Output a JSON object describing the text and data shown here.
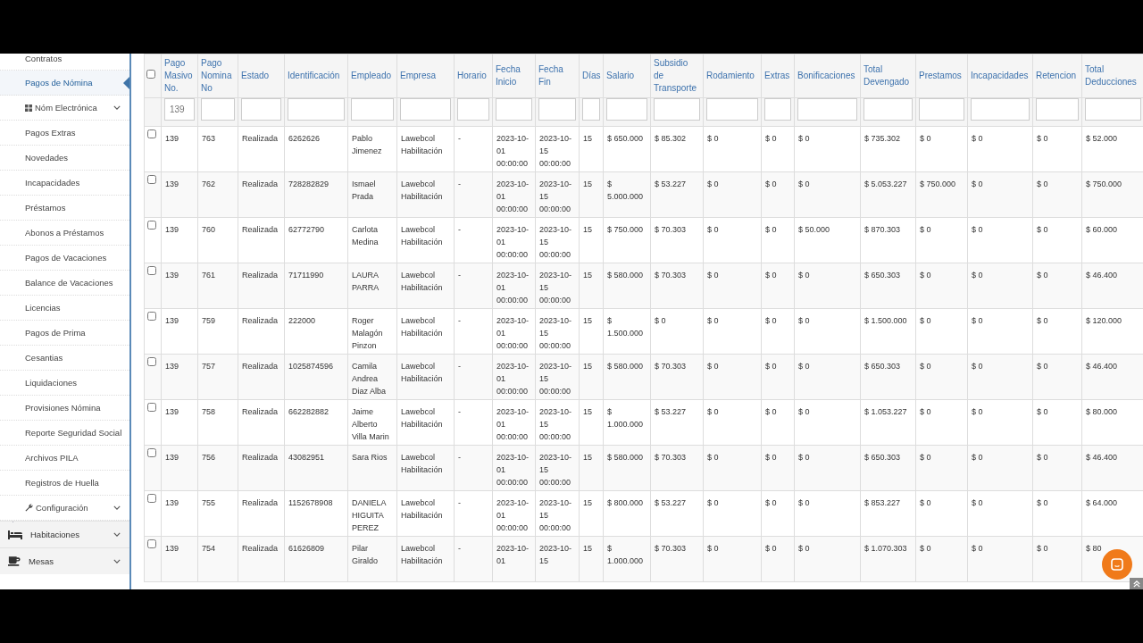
{
  "sidebar": {
    "items": [
      {
        "kind": "link",
        "label": "Contratos",
        "selected": false
      },
      {
        "kind": "link",
        "label": "Pagos de Nómina",
        "selected": true
      },
      {
        "kind": "submenu",
        "label": "Nóm Electrónica",
        "selected": false
      },
      {
        "kind": "link",
        "label": "Pagos Extras",
        "selected": false
      },
      {
        "kind": "link",
        "label": "Novedades",
        "selected": false
      },
      {
        "kind": "link",
        "label": "Incapacidades",
        "selected": false
      },
      {
        "kind": "link",
        "label": "Préstamos",
        "selected": false
      },
      {
        "kind": "link",
        "label": "Abonos a Préstamos",
        "selected": false
      },
      {
        "kind": "link",
        "label": "Pagos de Vacaciones",
        "selected": false
      },
      {
        "kind": "link",
        "label": "Balance de Vacaciones",
        "selected": false
      },
      {
        "kind": "link",
        "label": "Licencias",
        "selected": false
      },
      {
        "kind": "link",
        "label": "Pagos de Prima",
        "selected": false
      },
      {
        "kind": "link",
        "label": "Cesantias",
        "selected": false
      },
      {
        "kind": "link",
        "label": "Liquidaciones",
        "selected": false
      },
      {
        "kind": "link",
        "label": "Provisiones Nómina",
        "selected": false
      },
      {
        "kind": "link",
        "label": "Reporte Seguridad Social",
        "selected": false
      },
      {
        "kind": "link",
        "label": "Archivos PILA",
        "selected": false
      },
      {
        "kind": "link",
        "label": "Registros de Huella",
        "selected": false
      },
      {
        "kind": "submenu",
        "label": "Configuración",
        "selected": false
      },
      {
        "kind": "module",
        "label": "Habitaciones",
        "selected": false
      },
      {
        "kind": "module",
        "label": "Mesas",
        "selected": false
      }
    ]
  },
  "table": {
    "header_checkbox": {
      "checked": false
    },
    "columns": [
      {
        "label": "Pago Masivo No.",
        "filter": "139"
      },
      {
        "label": "Pago Nomina No"
      },
      {
        "label": "Estado"
      },
      {
        "label": "Identificación"
      },
      {
        "label": "Empleado"
      },
      {
        "label": "Empresa"
      },
      {
        "label": "Horario"
      },
      {
        "label": "Fecha Inicio"
      },
      {
        "label": "Fecha Fin"
      },
      {
        "label": "Días"
      },
      {
        "label": "Salario"
      },
      {
        "label": "Subsidio de Transporte"
      },
      {
        "label": "Rodamiento"
      },
      {
        "label": "Extras"
      },
      {
        "label": "Bonificaciones"
      },
      {
        "label": "Total Devengado"
      },
      {
        "label": "Prestamos"
      },
      {
        "label": "Incapacidades"
      },
      {
        "label": "Retencion"
      },
      {
        "label": "Total Deducciones"
      }
    ],
    "rows": [
      {
        "checked": false,
        "cells": [
          "139",
          "763",
          "Realizada",
          "6262626",
          "Pablo Jimenez",
          "Lawebcol Habilitación",
          "-",
          "2023-10-01 00:00:00",
          "2023-10-15 00:00:00",
          "15",
          "$ 650.000",
          "$ 85.302",
          "$ 0",
          "$ 0",
          "$ 0",
          "$ 735.302",
          "$ 0",
          "$ 0",
          "$ 0",
          "$ 52.000"
        ]
      },
      {
        "checked": false,
        "cells": [
          "139",
          "762",
          "Realizada",
          "728282829",
          "Ismael Prada",
          "Lawebcol Habilitación",
          "-",
          "2023-10-01 00:00:00",
          "2023-10-15 00:00:00",
          "15",
          "$ 5.000.000",
          "$ 53.227",
          "$ 0",
          "$ 0",
          "$ 0",
          "$ 5.053.227",
          "$ 750.000",
          "$ 0",
          "$ 0",
          "$ 750.000"
        ]
      },
      {
        "checked": false,
        "cells": [
          "139",
          "760",
          "Realizada",
          "62772790",
          "Carlota Medina",
          "Lawebcol Habilitación",
          "-",
          "2023-10-01 00:00:00",
          "2023-10-15 00:00:00",
          "15",
          "$ 750.000",
          "$ 70.303",
          "$ 0",
          "$ 0",
          "$ 50.000",
          "$ 870.303",
          "$ 0",
          "$ 0",
          "$ 0",
          "$ 60.000"
        ]
      },
      {
        "checked": false,
        "cells": [
          "139",
          "761",
          "Realizada",
          "71711990",
          "LAURA PARRA",
          "Lawebcol Habilitación",
          "-",
          "2023-10-01 00:00:00",
          "2023-10-15 00:00:00",
          "15",
          "$ 580.000",
          "$ 70.303",
          "$ 0",
          "$ 0",
          "$ 0",
          "$ 650.303",
          "$ 0",
          "$ 0",
          "$ 0",
          "$ 46.400"
        ]
      },
      {
        "checked": false,
        "cells": [
          "139",
          "759",
          "Realizada",
          "222000",
          "Roger Malagón Pinzon",
          "Lawebcol Habilitación",
          "-",
          "2023-10-01 00:00:00",
          "2023-10-15 00:00:00",
          "15",
          "$ 1.500.000",
          "$ 0",
          "$ 0",
          "$ 0",
          "$ 0",
          "$ 1.500.000",
          "$ 0",
          "$ 0",
          "$ 0",
          "$ 120.000"
        ]
      },
      {
        "checked": false,
        "cells": [
          "139",
          "757",
          "Realizada",
          "1025874596",
          "Camila Andrea Diaz Alba",
          "Lawebcol Habilitación",
          "-",
          "2023-10-01 00:00:00",
          "2023-10-15 00:00:00",
          "15",
          "$ 580.000",
          "$ 70.303",
          "$ 0",
          "$ 0",
          "$ 0",
          "$ 650.303",
          "$ 0",
          "$ 0",
          "$ 0",
          "$ 46.400"
        ]
      },
      {
        "checked": false,
        "cells": [
          "139",
          "758",
          "Realizada",
          "662282882",
          "Jaime Alberto Villa Marin",
          "Lawebcol Habilitación",
          "-",
          "2023-10-01 00:00:00",
          "2023-10-15 00:00:00",
          "15",
          "$ 1.000.000",
          "$ 53.227",
          "$ 0",
          "$ 0",
          "$ 0",
          "$ 1.053.227",
          "$ 0",
          "$ 0",
          "$ 0",
          "$ 80.000"
        ]
      },
      {
        "checked": false,
        "cells": [
          "139",
          "756",
          "Realizada",
          "43082951",
          "Sara Rios",
          "Lawebcol Habilitación",
          "-",
          "2023-10-01 00:00:00",
          "2023-10-15 00:00:00",
          "15",
          "$ 580.000",
          "$ 70.303",
          "$ 0",
          "$ 0",
          "$ 0",
          "$ 650.303",
          "$ 0",
          "$ 0",
          "$ 0",
          "$ 46.400"
        ]
      },
      {
        "checked": false,
        "cells": [
          "139",
          "755",
          "Realizada",
          "1152678908",
          "DANIELA HIGUITA PEREZ",
          "Lawebcol Habilitación",
          "-",
          "2023-10-01 00:00:00",
          "2023-10-15 00:00:00",
          "15",
          "$ 800.000",
          "$ 53.227",
          "$ 0",
          "$ 0",
          "$ 0",
          "$ 853.227",
          "$ 0",
          "$ 0",
          "$ 0",
          "$ 64.000"
        ]
      },
      {
        "checked": false,
        "cells": [
          "139",
          "754",
          "Realizada",
          "61626809",
          "Pilar Giraldo",
          "Lawebcol Habilitación",
          "-",
          "2023-10-01",
          "2023-10-15",
          "15",
          "$ 1.000.000",
          "$ 70.303",
          "$ 0",
          "$ 0",
          "$ 0",
          "$ 1.070.303",
          "$ 0",
          "$ 0",
          "$ 0",
          "$ 80"
        ]
      }
    ]
  }
}
